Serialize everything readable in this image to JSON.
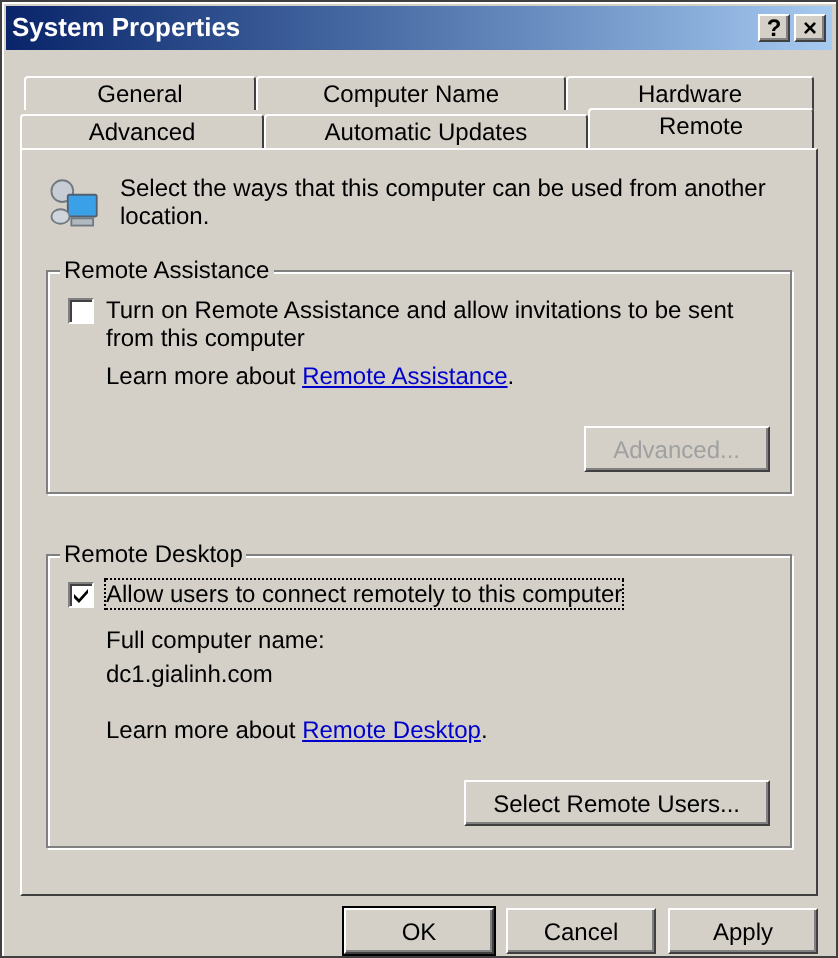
{
  "window": {
    "title": "System Properties",
    "title_buttons": [
      "?",
      "×"
    ]
  },
  "tab_rows": [
    {
      "tabs": [
        {
          "label": "General",
          "selected": false
        },
        {
          "label": "Computer Name",
          "selected": false
        },
        {
          "label": "Hardware",
          "selected": false
        }
      ]
    },
    {
      "tabs": [
        {
          "label": "Advanced",
          "selected": false
        },
        {
          "label": "Automatic Updates",
          "selected": false
        },
        {
          "label": "Remote",
          "selected": true
        }
      ]
    }
  ],
  "intro": "Select the ways that this computer can be used from another location.",
  "groups": [
    {
      "title": "Remote Assistance",
      "checkbox": {
        "label": "Turn on Remote Assistance and allow invitations to be sent from this computer",
        "checked": false,
        "focused": false
      },
      "learn_more": {
        "before": "Learn more about ",
        "link": "Remote Assistance",
        "after": "."
      },
      "button": {
        "label": "Advanced...",
        "disabled": true
      }
    },
    {
      "title": "Remote Desktop",
      "checkbox": {
        "label": "Allow users to connect remotely to this computer",
        "checked": true,
        "focused": true
      },
      "details": [
        "Full computer name:",
        "dc1.gialinh.com"
      ],
      "learn_more": {
        "before": "Learn more about ",
        "link": "Remote Desktop",
        "after": "."
      },
      "button": {
        "label": "Select Remote Users...",
        "disabled": false
      }
    }
  ],
  "buttons": [
    {
      "label": "OK",
      "default": true
    },
    {
      "label": "Cancel",
      "default": false
    },
    {
      "label": "Apply",
      "default": false
    }
  ]
}
